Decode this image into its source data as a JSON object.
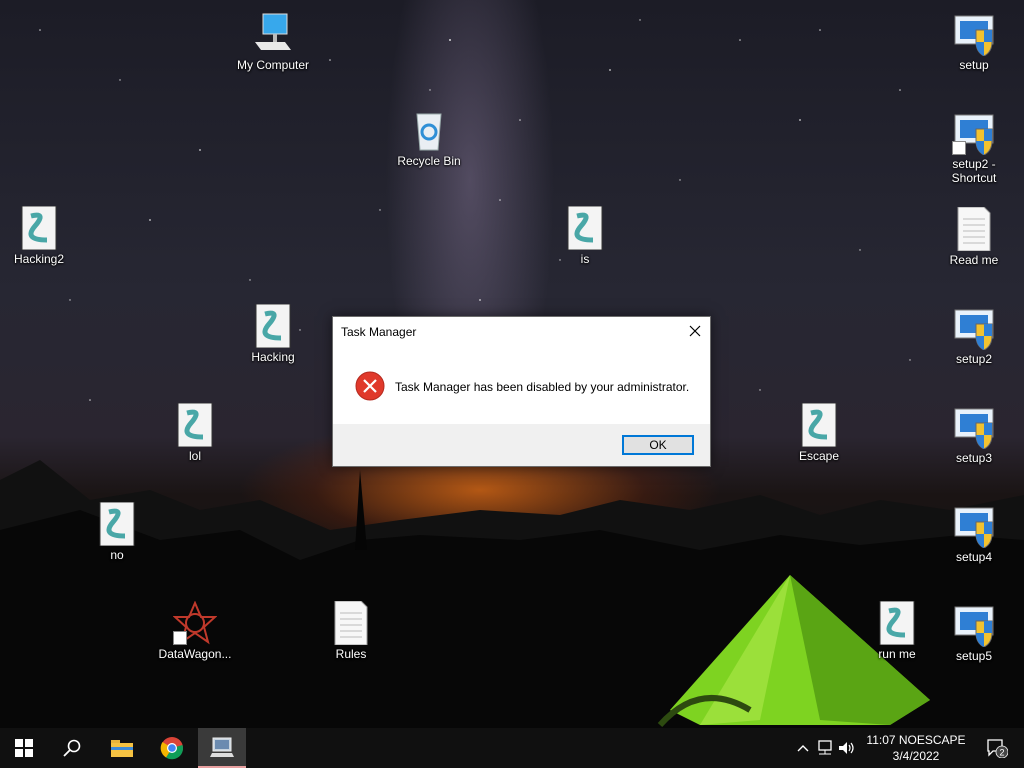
{
  "desktop": {
    "icons": {
      "my_computer": "My Computer",
      "recycle_bin": "Recycle Bin",
      "hacking2": "Hacking2",
      "is": "is",
      "hacking": "Hacking",
      "lol": "lol",
      "no": "no",
      "datawagon": "DataWagon...",
      "rules": "Rules",
      "escape": "Escape",
      "run_me": "run me",
      "setup": "setup",
      "setup2_shortcut_line1": "setup2 -",
      "setup2_shortcut_line2": "Shortcut",
      "read_me": "Read me",
      "setup2": "setup2",
      "setup3": "setup3",
      "setup4": "setup4",
      "setup5": "setup5"
    }
  },
  "dialog": {
    "title": "Task Manager",
    "message": "Task Manager has been disabled by your administrator.",
    "ok_label": "OK",
    "icon": "error-icon"
  },
  "taskbar": {
    "apps": [
      "start-icon",
      "search-icon",
      "file-explorer-icon",
      "chrome-icon",
      "system-tool-icon"
    ],
    "tray": {
      "time_line": "11:07 NOESCAPE",
      "date": "3/4/2022",
      "notification_count": "2"
    }
  },
  "colors": {
    "accent": "#0078d7",
    "error_red": "#e0392b",
    "taskbar": "#101010",
    "tent_green": "#7ed321"
  }
}
